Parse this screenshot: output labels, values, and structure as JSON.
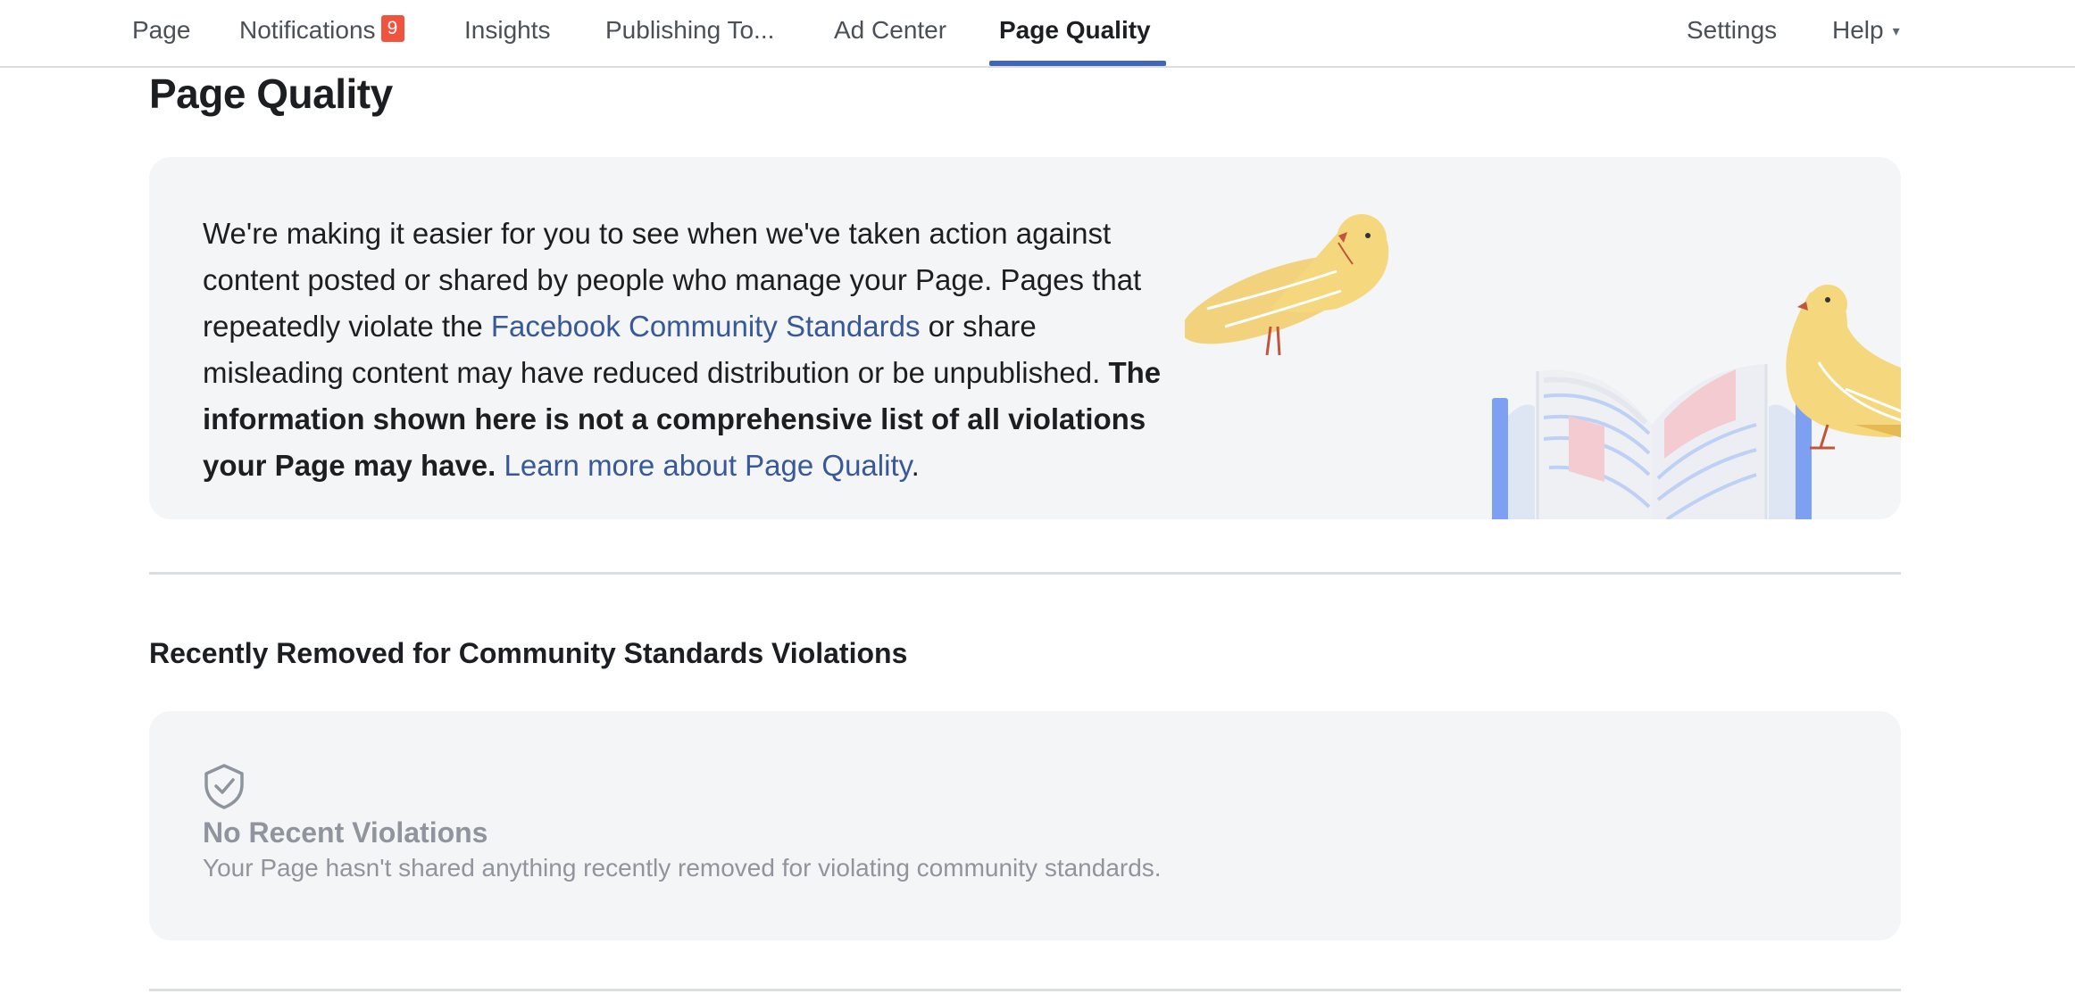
{
  "nav": {
    "items": [
      {
        "label": "Page"
      },
      {
        "label": "Notifications",
        "badge": "9"
      },
      {
        "label": "Insights"
      },
      {
        "label": "Publishing To..."
      },
      {
        "label": "Ad Center"
      },
      {
        "label": "Page Quality",
        "active": true
      }
    ],
    "settings": "Settings",
    "help": "Help",
    "help_caret": "▾",
    "accent_color": "#4267b2",
    "badge_color": "#f0533e"
  },
  "page_title": "Page Quality",
  "intro": {
    "text_1": "We're making it easier for you to see when we've taken action against content posted or shared by people who manage your Page. Pages that repeatedly violate the ",
    "link_standards": "Facebook Community Standards",
    "text_2": " or share misleading content may have reduced distribution or be unpublished. ",
    "bold_text": "The information shown here is not a comprehensive list of all violations your Page may have.",
    "text_3": " ",
    "link_learn": "Learn more about Page Quality",
    "text_4": ".",
    "illustration": "two-yellow-birds-and-open-book"
  },
  "section": {
    "title": "Recently Removed for Community Standards Violations"
  },
  "empty_state": {
    "icon": "shield-check-icon",
    "title": "No Recent Violations",
    "description": "Your Page hasn't shared anything recently removed for violating community standards."
  }
}
